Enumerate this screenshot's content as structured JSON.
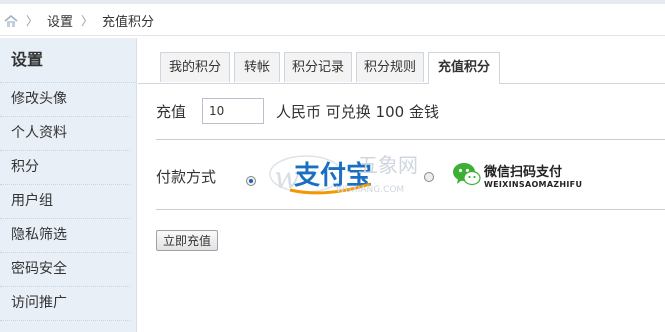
{
  "breadcrumb": {
    "items": [
      "设置",
      "充值积分"
    ]
  },
  "sidebar": {
    "title": "设置",
    "items": [
      {
        "label": "修改头像"
      },
      {
        "label": "个人资料"
      },
      {
        "label": "积分"
      },
      {
        "label": "用户组"
      },
      {
        "label": "隐私筛选"
      },
      {
        "label": "密码安全"
      },
      {
        "label": "访问推广"
      }
    ]
  },
  "tabs": [
    {
      "label": "我的积分"
    },
    {
      "label": "转帐"
    },
    {
      "label": "积分记录"
    },
    {
      "label": "积分规则"
    },
    {
      "label": "充值积分",
      "active": true
    }
  ],
  "recharge": {
    "label": "充值",
    "amount": "10",
    "exchange_text": "人民币 可兑换  100 金钱"
  },
  "payment": {
    "label": "付款方式",
    "alipay": {
      "name": "支付宝",
      "watermark": "五象网",
      "watermark_domain": "WUXIANG.COM"
    },
    "wechat": {
      "name": "微信扫码支付",
      "subtitle": "WEIXINSAOMAZHIFU"
    }
  },
  "submit": {
    "label": "立即充值"
  },
  "colors": {
    "sidebar_bg": "#e8eff7",
    "alipay_blue": "#1a6fc0",
    "alipay_orange": "#f39800",
    "wechat_green": "#3cb034"
  }
}
